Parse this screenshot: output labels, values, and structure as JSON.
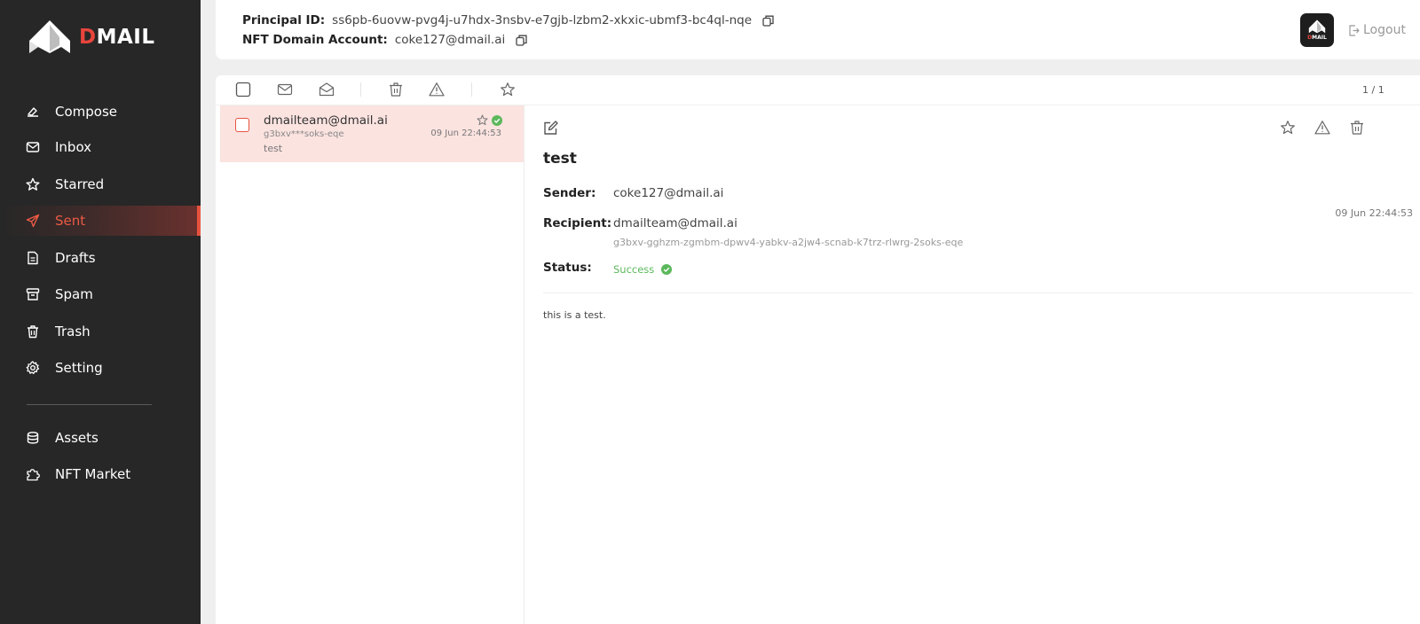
{
  "brand": {
    "name_d": "D",
    "name_rest": "MAIL",
    "accent": "#e8453c"
  },
  "sidebar": {
    "items": [
      {
        "label": "Compose",
        "icon": "compose-icon"
      },
      {
        "label": "Inbox",
        "icon": "inbox-icon"
      },
      {
        "label": "Starred",
        "icon": "star-icon"
      },
      {
        "label": "Sent",
        "icon": "send-icon",
        "active": true
      },
      {
        "label": "Drafts",
        "icon": "drafts-icon"
      },
      {
        "label": "Spam",
        "icon": "spam-icon"
      },
      {
        "label": "Trash",
        "icon": "trash-icon"
      },
      {
        "label": "Setting",
        "icon": "gear-icon"
      },
      {
        "label": "Assets",
        "icon": "assets-icon"
      },
      {
        "label": "NFT Market",
        "icon": "puzzle-icon"
      }
    ]
  },
  "header": {
    "principal_label": "Principal ID:",
    "principal_value": "ss6pb-6uovw-pvg4j-u7hdx-3nsbv-e7gjb-lzbm2-xkxic-ubmf3-bc4ql-nqe",
    "domain_label": "NFT Domain Account:",
    "domain_value": "coke127@dmail.ai",
    "logout_label": "Logout"
  },
  "toolbar": {
    "pager": "1 / 1"
  },
  "mail_list": [
    {
      "from": "dmailteam@dmail.ai",
      "address": "g3bxv***soks-eqe",
      "subject": "test",
      "date": "09 Jun 22:44:53"
    }
  ],
  "detail": {
    "subject": "test",
    "sender_label": "Sender:",
    "sender": "coke127@dmail.ai",
    "recipient_label": "Recipient:",
    "recipient": "dmailteam@dmail.ai",
    "recipient_principal": "g3bxv-gghzm-zgmbm-dpwv4-yabkv-a2jw4-scnab-k7trz-rlwrg-2soks-eqe",
    "status_label": "Status:",
    "status": "Success",
    "date": "09 Jun 22:44:53",
    "body": "this is a test."
  },
  "colors": {
    "success": "#5cb85c",
    "selected_row": "#fbe3e0",
    "sidebar_bg": "#272727"
  }
}
